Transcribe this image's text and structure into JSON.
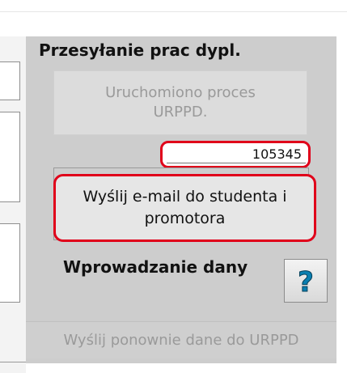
{
  "panel": {
    "title": "Przesyłanie prac dypl.",
    "status_button": "Uruchomiono proces URPPD.",
    "record_number": "105345",
    "email_button": "Wyślij e-mail do studenta i promotora",
    "section_label": "Wprowadzanie dany",
    "help_glyph": "?",
    "resend_button": "Wyślij ponownie dane do URPPD"
  },
  "colors": {
    "highlight": "#e0001a",
    "panel_bg": "#cdcdcd",
    "help_icon": "#0a7fb0"
  },
  "icons": {
    "help": "question-mark-icon"
  }
}
